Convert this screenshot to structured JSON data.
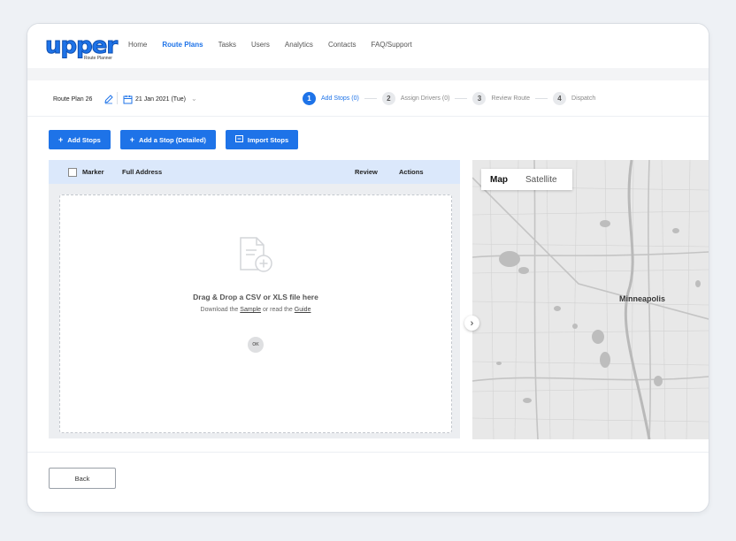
{
  "brand": {
    "logo_text": "upper",
    "logo_sub": "Route Planner",
    "color": "#1e73e8"
  },
  "nav": {
    "items": [
      {
        "label": "Home"
      },
      {
        "label": "Route Plans",
        "active": true
      },
      {
        "label": "Tasks"
      },
      {
        "label": "Users"
      },
      {
        "label": "Analytics"
      },
      {
        "label": "Contacts"
      },
      {
        "label": "FAQ/Support"
      }
    ]
  },
  "plan": {
    "name": "Route Plan 26",
    "date": "21 Jan 2021 (Tue)"
  },
  "steps": [
    {
      "num": "1",
      "label": "Add Stops (0)",
      "active": true
    },
    {
      "num": "2",
      "label": "Assign Drivers (0)"
    },
    {
      "num": "3",
      "label": "Review Route"
    },
    {
      "num": "4",
      "label": "Dispatch"
    }
  ],
  "actions": {
    "add_stops": "Add Stops",
    "add_stop_detailed": "Add a Stop (Detailed)",
    "import_stops": "Import Stops"
  },
  "table": {
    "columns": {
      "marker": "Marker",
      "address": "Full Address",
      "review": "Review",
      "actions": "Actions"
    }
  },
  "dropzone": {
    "title": "Drag & Drop a CSV or XLS file here",
    "sub_prefix": "Download the",
    "sample": "Sample",
    "sub_mid": "or read the",
    "guide": "Guide",
    "ok": "OK"
  },
  "map": {
    "tabs": [
      "Map",
      "Satellite"
    ],
    "active_tab": "Map",
    "city_label": "Minneapolis"
  },
  "footer": {
    "back": "Back"
  }
}
